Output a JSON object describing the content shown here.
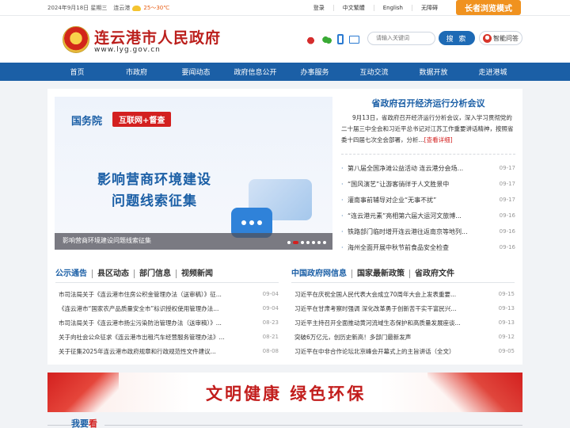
{
  "topbar": {
    "date": "2024年9月18日 星期三",
    "city": "连云港",
    "temp": "25～30℃",
    "links": [
      "登录",
      "中文繁體",
      "English",
      "无障碍"
    ],
    "elder_mode": "长者浏览模式"
  },
  "header": {
    "title": "连云港市人民政府",
    "url": "www.lyg.gov.cn",
    "search_placeholder": "请输入关键词",
    "search_label": "搜 索",
    "ai_label": "智能问答"
  },
  "nav": [
    "首页",
    "市政府",
    "要闻动态",
    "政府信息公开",
    "办事服务",
    "互动交流",
    "数据开放",
    "走进港城"
  ],
  "banner": {
    "org": "国务院",
    "tag": "互联网+督查",
    "headline1": "影响营商环境建设",
    "headline2": "问题线索征集",
    "caption": "影响营商环境建设问题线索征集"
  },
  "headline": {
    "title": "省政府召开经济运行分析会议",
    "summary": "9月13日，省政府召开经济运行分析会议，深入学习贯彻党的二十届三中全会和习近平总书记对江苏工作重要讲话精神，按照省委十四届七次全会部署，分析...",
    "more": "[查看详细]"
  },
  "news": [
    {
      "title": "第八届全国净滩公益活动 连云港分会场...",
      "date": "09-17"
    },
    {
      "title": "“国风演艺”让游客徜徉于人文胜景中",
      "date": "09-17"
    },
    {
      "title": "灌南事前辅导对企业“无事不扰”",
      "date": "09-17"
    },
    {
      "title": "“连云港元素”亮相第六届大运河文旅博...",
      "date": "09-16"
    },
    {
      "title": "铁路部门临时增开连云港往返南京等地列...",
      "date": "09-16"
    },
    {
      "title": "海州全面开展中秋节前食品安全检查",
      "date": "09-16"
    }
  ],
  "tabs_left": [
    "公示通告",
    "县区动态",
    "部门信息",
    "视频新闻"
  ],
  "tabs_right": [
    "中国政府网信息",
    "国家最新政策",
    "省政府文件"
  ],
  "list_left": [
    {
      "title": "市司法局关于《连云港市住房公积金管理办法（送审稿）》征...",
      "date": "09-04"
    },
    {
      "title": "《连云港市“国家农产品质量安全市”标识授权使用管理办法...",
      "date": "09-04"
    },
    {
      "title": "市司法局关于《连云港市扬尘污染防治管理办法（送审稿）》...",
      "date": "08-23"
    },
    {
      "title": "关于向社会公众征求《连云港市出租汽车经营服务管理办法》...",
      "date": "08-21"
    },
    {
      "title": "关于征集2025年连云港市政府规章和行政规范性文件建议...",
      "date": "08-08"
    }
  ],
  "list_right": [
    {
      "title": "习近平在庆祝全国人民代表大会成立70周年大会上发表重要...",
      "date": "09-15"
    },
    {
      "title": "习近平在甘肃考察时强调 深化改革勇于创新苦干实干富民兴...",
      "date": "09-13"
    },
    {
      "title": "习近平主持召开全面推动黄河流域生态保护和高质量发展座谈...",
      "date": "09-13"
    },
    {
      "title": "突破6万亿元，创历史新高！多部门最新发声",
      "date": "09-12"
    },
    {
      "title": "习近平在中非合作论坛北京峰会开幕式上的主旨讲话（全文）",
      "date": "09-05"
    }
  ],
  "civ_banner": "文明健康 绿色环保",
  "want": {
    "a": "我要",
    "b": "看"
  },
  "colors": {
    "brand_blue": "#1b5fa6",
    "brand_red": "#bb1f1c",
    "accent_orange": "#f0921f"
  }
}
